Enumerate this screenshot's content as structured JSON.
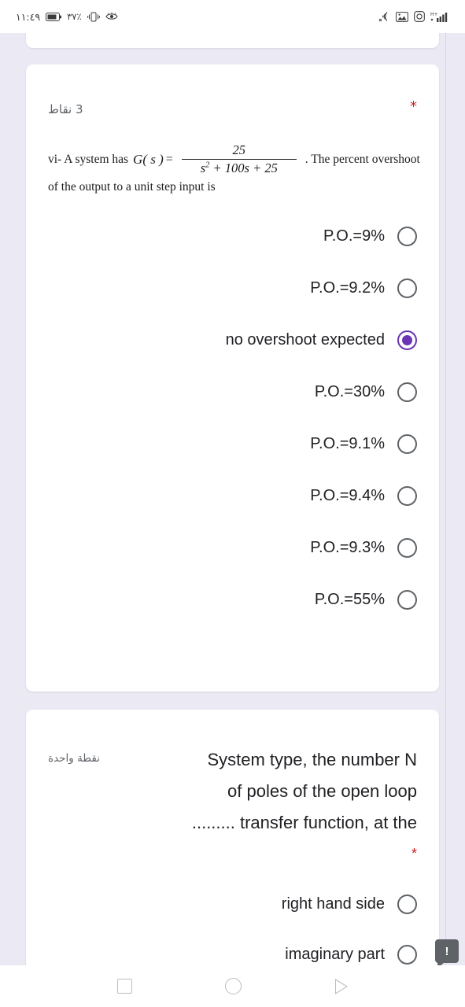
{
  "status_bar": {
    "time": "١١:٤٩",
    "battery_percent": "٣٧٪",
    "icons": [
      "battery-icon",
      "vibrate-icon",
      "eye-icon",
      "nfc-off-icon",
      "screenshot-icon",
      "camera-icon",
      "signal-bars-icon"
    ]
  },
  "question1": {
    "points_label": "3 نقاط",
    "required_marker": "*",
    "prompt": {
      "lead": "vi- A system has",
      "function_name": "G( s )",
      "equals": "=",
      "numerator": "25",
      "denominator": "s2 + 100s + 25",
      "denominator_base": "s",
      "denominator_exp": "2",
      "denominator_rest": "+ 100s + 25",
      "tail": ". The percent overshoot",
      "line2": "of the output to a unit step input is"
    },
    "options": [
      {
        "label": "P.O.=9%",
        "selected": false
      },
      {
        "label": "P.O.=9.2%",
        "selected": false
      },
      {
        "label": "no overshoot expected",
        "selected": true
      },
      {
        "label": "P.O.=30%",
        "selected": false
      },
      {
        "label": "P.O.=9.1%",
        "selected": false
      },
      {
        "label": "P.O.=9.4%",
        "selected": false
      },
      {
        "label": "P.O.=9.3%",
        "selected": false
      },
      {
        "label": "P.O.=55%",
        "selected": false
      }
    ]
  },
  "question2": {
    "points_label": "نقطة واحدة",
    "required_marker": "*",
    "text_line1": "System type, the number N",
    "text_line2": "of poles of the open loop",
    "text_line3": "......... transfer function, at the",
    "options": [
      {
        "label": "right hand side",
        "selected": false
      },
      {
        "label": "imaginary part",
        "selected": false
      }
    ]
  },
  "floating_badge": {
    "label": "!"
  },
  "nav_bar": {
    "recents": "recents-square-icon",
    "home": "home-circle-icon",
    "back": "back-triangle-icon"
  },
  "colors": {
    "page_background": "#ebe9f4",
    "card": "#ffffff",
    "accent_purple": "#6a35b5",
    "required_red": "#c5221f",
    "text_primary": "#202124",
    "text_secondary": "#5f6368"
  }
}
